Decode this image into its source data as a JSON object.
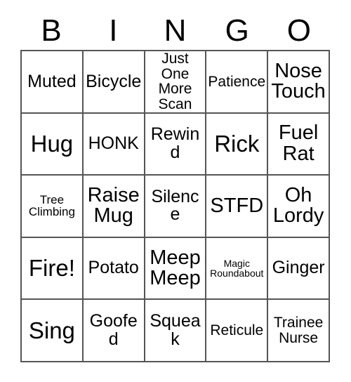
{
  "card": {
    "header_letters": [
      "B",
      "I",
      "N",
      "G",
      "O"
    ],
    "rows": [
      [
        {
          "text": "Muted",
          "size": "fs-md"
        },
        {
          "text": "Bicycle",
          "size": "fs-md"
        },
        {
          "text": "Just One\nMore\nScan",
          "size": "fs-sm"
        },
        {
          "text": "Patience",
          "size": "fs-sm"
        },
        {
          "text": "Nose\nTouch",
          "size": "fs-lg"
        }
      ],
      [
        {
          "text": "Hug",
          "size": "fs-xl"
        },
        {
          "text": "HONK",
          "size": "fs-md"
        },
        {
          "text": "Rewind",
          "size": "fs-md"
        },
        {
          "text": "Rick",
          "size": "fs-xl"
        },
        {
          "text": "Fuel\nRat",
          "size": "fs-lg"
        }
      ],
      [
        {
          "text": "Tree\nClimbing",
          "size": "fs-xs"
        },
        {
          "text": "Raise\nMug",
          "size": "fs-lg"
        },
        {
          "text": "Silence",
          "size": "fs-md"
        },
        {
          "text": "STFD",
          "size": "fs-lg"
        },
        {
          "text": "Oh\nLordy",
          "size": "fs-lg"
        }
      ],
      [
        {
          "text": "Fire!",
          "size": "fs-xl"
        },
        {
          "text": "Potato",
          "size": "fs-md"
        },
        {
          "text": "Meep\nMeep",
          "size": "fs-lg"
        },
        {
          "text": "Magic\nRoundabout",
          "size": "fs-xxs"
        },
        {
          "text": "Ginger",
          "size": "fs-md"
        }
      ],
      [
        {
          "text": "Sing",
          "size": "fs-xl"
        },
        {
          "text": "Goofed",
          "size": "fs-md"
        },
        {
          "text": "Squeak",
          "size": "fs-md"
        },
        {
          "text": "Reticule",
          "size": "fs-sm"
        },
        {
          "text": "Trainee\nNurse",
          "size": "fs-sm"
        }
      ]
    ],
    "colors": {
      "border": "#555555",
      "text": "#000000",
      "background": "#ffffff"
    }
  }
}
